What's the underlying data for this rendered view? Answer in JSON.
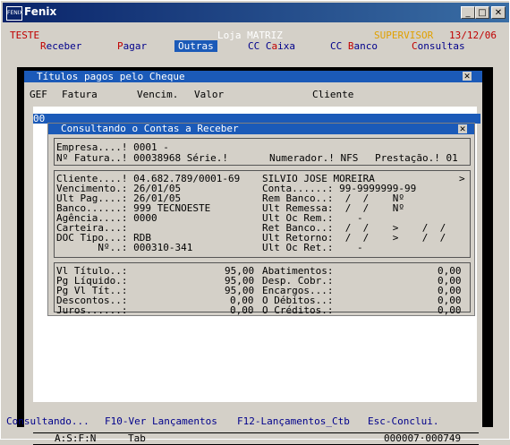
{
  "window": {
    "title": "Fenix",
    "icon_label": "FENIX",
    "minimize": "_",
    "maximize": "□",
    "close": "✕"
  },
  "header": {
    "company": "TESTE",
    "store": "Loja MATRIZ",
    "user": "SUPERVISOR",
    "date": "13/12/06"
  },
  "menu": {
    "receber": {
      "hk": "R",
      "rest": "eceber"
    },
    "pagar": {
      "hk": "P",
      "rest": "agar"
    },
    "outras": {
      "hk": "O",
      "rest": "utras"
    },
    "caixa": {
      "pre": "CC C",
      "hk": "a",
      "rest": "ixa"
    },
    "banco": {
      "pre": "CC ",
      "hk": "B",
      "rest": "anco"
    },
    "consultas": {
      "hk": "C",
      "rest": "onsultas"
    }
  },
  "outer_dialog": {
    "title": "Títulos pagos pelo Cheque",
    "headers": {
      "gef": "GEF",
      "fatura": "Fatura",
      "vencim": "Vencim.",
      "valor": "Valor",
      "cliente": "Cliente"
    },
    "row_fragment": "00",
    "status_left": "A:S:F:N",
    "status_mid": "Tab",
    "status_right": "000007·000749"
  },
  "inner_dialog": {
    "title": "Consultando o Contas a Receber",
    "empresa": "Empresa....! 0001 -",
    "fatura": "Nº Fatura..! 00038968 Série.!",
    "numerador": "Numerador.! NFS",
    "prestacao": "Prestação.! 01",
    "left_lines": [
      "Cliente....! 04.682.789/0001-69",
      "Vencimento.: 26/01/05",
      "Ult Pag....: 26/01/05",
      "Banco......: 999 TECNOESTE",
      "Agência....: 0000",
      "Carteira...:",
      "DOC Tipo...: RDB",
      "       Nº..: 000310-341"
    ],
    "right_lines": [
      "SILVIO JOSE MOREIRA",
      "Conta......: 99-9999999-99",
      "Rem Banco..:  /  /    Nº",
      "Ult Remessa:  /  /    Nº",
      "Ult Oc Rem.:    -",
      "Ret Banco..:  /  /    >    /  /",
      "Ult Retorno:  /  /    >    /  /",
      "Ult Oc Ret.:    -"
    ],
    "arrow": ">",
    "values_left": [
      {
        "label": "Vl Título..:",
        "value": "95,00"
      },
      {
        "label": "Pg Líquido.:",
        "value": "95,00"
      },
      {
        "label": "Pg Vl Tít..:",
        "value": "95,00"
      },
      {
        "label": "Descontos..:",
        "value": "0,00"
      },
      {
        "label": "Juros......:",
        "value": "0,00"
      }
    ],
    "values_right": [
      {
        "label": "Abatimentos:",
        "value": "0,00"
      },
      {
        "label": "Desp. Cobr.:",
        "value": "0,00"
      },
      {
        "label": "Encargos...:",
        "value": "0,00"
      },
      {
        "label": "O Débitos..:",
        "value": "0,00"
      },
      {
        "label": "O Créditos.:",
        "value": "0,00"
      }
    ]
  },
  "footer": {
    "consultando": "Consultando...",
    "f10": "F10-Ver Lançamentos",
    "f12": "F12-Lançamentos_Ctb",
    "esc": "Esc-Conclui."
  }
}
